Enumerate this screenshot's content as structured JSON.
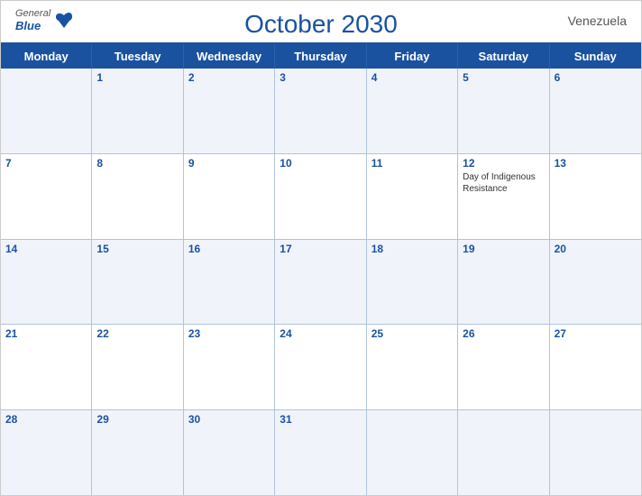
{
  "header": {
    "title": "October 2030",
    "country": "Venezuela",
    "logo": {
      "general": "General",
      "blue": "Blue"
    }
  },
  "dayHeaders": [
    "Monday",
    "Tuesday",
    "Wednesday",
    "Thursday",
    "Friday",
    "Saturday",
    "Sunday"
  ],
  "weeks": [
    [
      {
        "day": "",
        "empty": true
      },
      {
        "day": "1"
      },
      {
        "day": "2"
      },
      {
        "day": "3"
      },
      {
        "day": "4"
      },
      {
        "day": "5"
      },
      {
        "day": "6"
      }
    ],
    [
      {
        "day": "7"
      },
      {
        "day": "8"
      },
      {
        "day": "9"
      },
      {
        "day": "10"
      },
      {
        "day": "11"
      },
      {
        "day": "12",
        "holiday": "Day of Indigenous Resistance"
      },
      {
        "day": "13"
      }
    ],
    [
      {
        "day": "14"
      },
      {
        "day": "15"
      },
      {
        "day": "16"
      },
      {
        "day": "17"
      },
      {
        "day": "18"
      },
      {
        "day": "19"
      },
      {
        "day": "20"
      }
    ],
    [
      {
        "day": "21"
      },
      {
        "day": "22"
      },
      {
        "day": "23"
      },
      {
        "day": "24"
      },
      {
        "day": "25"
      },
      {
        "day": "26"
      },
      {
        "day": "27"
      }
    ],
    [
      {
        "day": "28"
      },
      {
        "day": "29"
      },
      {
        "day": "30"
      },
      {
        "day": "31"
      },
      {
        "day": "",
        "empty": true
      },
      {
        "day": "",
        "empty": true
      },
      {
        "day": "",
        "empty": true
      }
    ]
  ]
}
